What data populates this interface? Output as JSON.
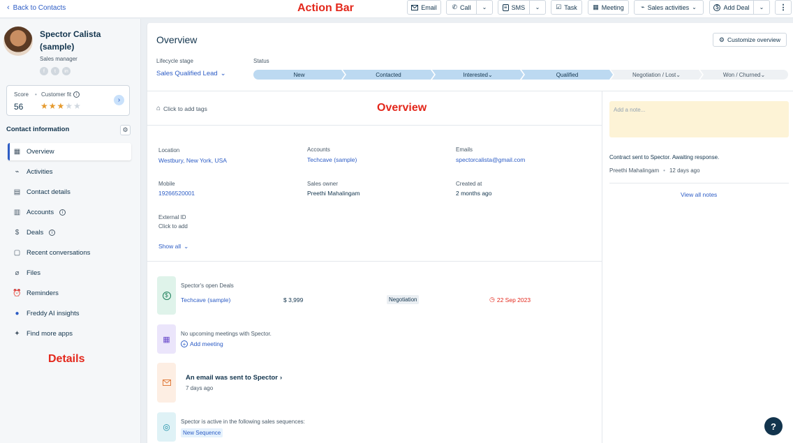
{
  "topbar": {
    "back_label": "Back to Contacts",
    "annotation": "Action Bar",
    "email": "Email",
    "call": "Call",
    "sms": "SMS",
    "task": "Task",
    "meeting": "Meeting",
    "sales_activities": "Sales activities",
    "add_deal": "Add Deal"
  },
  "contact": {
    "name_line1": "Spector Calista",
    "name_line2": "(sample)",
    "role": "Sales manager",
    "social": [
      "f",
      "t",
      "in"
    ],
    "score_label": "Score",
    "score_value": "56",
    "customer_fit_label": "Customer fit",
    "customer_fit_stars": 3,
    "customer_fit_max": 5
  },
  "sidebar": {
    "section_title": "Contact information",
    "annotation": "Details",
    "items": [
      {
        "label": "Overview",
        "icon": "grid-icon"
      },
      {
        "label": "Activities",
        "icon": "pulse-icon"
      },
      {
        "label": "Contact details",
        "icon": "id-card-icon"
      },
      {
        "label": "Accounts",
        "icon": "building-icon"
      },
      {
        "label": "Deals",
        "icon": "dollar-icon"
      },
      {
        "label": "Recent conversations",
        "icon": "chat-icon"
      },
      {
        "label": "Files",
        "icon": "paperclip-icon"
      },
      {
        "label": "Reminders",
        "icon": "alarm-icon"
      },
      {
        "label": "Freddy AI insights",
        "icon": "freddy-icon"
      },
      {
        "label": "Find more apps",
        "icon": "puzzle-icon"
      }
    ]
  },
  "overview": {
    "title": "Overview",
    "customize_label": "Customize overview",
    "annotation": "Overview",
    "lifecycle_label": "Lifecycle stage",
    "lifecycle_value": "Sales Qualified Lead",
    "status_label": "Status",
    "stages": [
      "New",
      "Contacted",
      "Interested",
      "Qualified",
      "Negotiation / Lost",
      "Won / Churned"
    ],
    "tags_placeholder": "Click to add tags",
    "fields": {
      "location_label": "Location",
      "location_value": "Westbury, New York, USA",
      "accounts_label": "Accounts",
      "accounts_value": "Techcave (sample)",
      "emails_label": "Emails",
      "emails_value": "spectorcalista@gmail.com",
      "mobile_label": "Mobile",
      "mobile_value": "19266520001",
      "owner_label": "Sales owner",
      "owner_value": "Preethi Mahalingam",
      "created_label": "Created at",
      "created_value": "2 months ago",
      "external_label": "External ID",
      "external_value": "Click to add"
    },
    "show_all": "Show all",
    "deals": {
      "heading": "Spector's open Deals",
      "name": "Techcave (sample)",
      "amount": "$ 3,999",
      "stage": "Negotiation",
      "date": "22 Sep 2023"
    },
    "meetings": {
      "text": "No upcoming meetings with Spector.",
      "add_label": "Add meeting"
    },
    "email": {
      "title": "An email was sent to Spector",
      "time": "7 days ago"
    },
    "sequences": {
      "text": "Spector is active in the following sales sequences:",
      "tag": "New Sequence"
    }
  },
  "notes": {
    "placeholder": "Add a note...",
    "latest_text": "Contract sent to Spector. Awaiting response.",
    "latest_author": "Preethi Mahalingam",
    "latest_time": "12 days ago",
    "view_all": "View all notes"
  },
  "help_label": "?",
  "colors": {
    "link": "#2c5cc5",
    "text": "#12344d",
    "stage_done": "#bcd9f1",
    "annotation": "#e3271b",
    "overdue": "#e3271b"
  }
}
